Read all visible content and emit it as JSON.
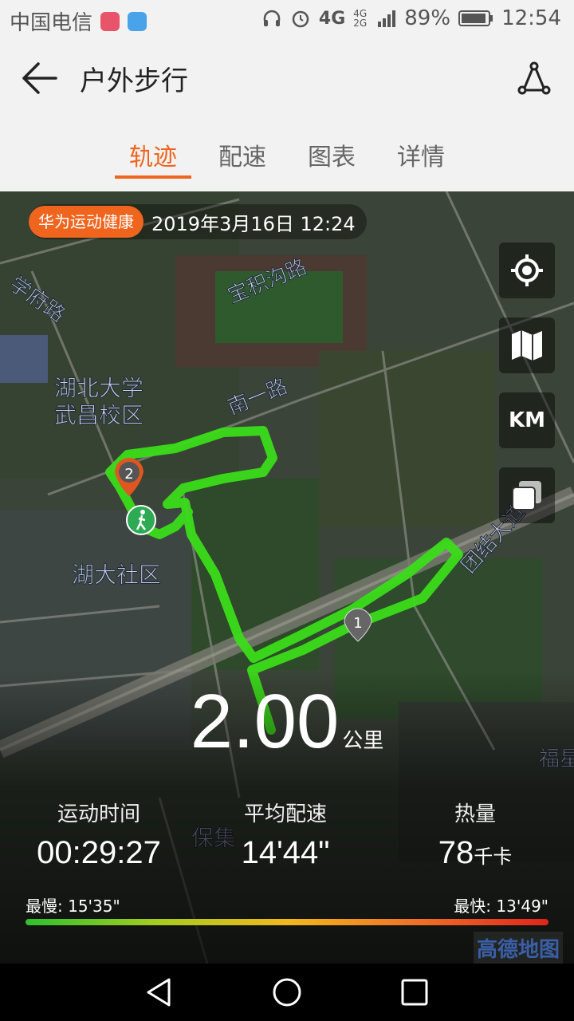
{
  "status_bar": {
    "carrier": "中国电信",
    "network": "4G",
    "network_small": "4G 2G",
    "battery": "89%",
    "time": "12:54"
  },
  "header": {
    "title": "户外步行"
  },
  "tabs": [
    {
      "label": "轨迹",
      "active": true
    },
    {
      "label": "配速",
      "active": false
    },
    {
      "label": "图表",
      "active": false
    },
    {
      "label": "详情",
      "active": false
    }
  ],
  "map": {
    "badge": "华为运动健康",
    "datetime": "2019年3月16日 12:24",
    "unit_button": "KM",
    "labels": [
      "学府路",
      "宝积沟路",
      "南一路",
      "湖北大学",
      "武昌校区",
      "湖大社区",
      "团结大道",
      "福星",
      "保集"
    ],
    "markers": [
      "1",
      "2"
    ],
    "route_color": "#3bdc1a",
    "provider": "高德地图"
  },
  "summary": {
    "distance": "2.00",
    "distance_unit": "公里",
    "stats": [
      {
        "label": "运动时间",
        "value": "00:29:27",
        "unit": ""
      },
      {
        "label": "平均配速",
        "value": "14'44\"",
        "unit": ""
      },
      {
        "label": "热量",
        "value": "78",
        "unit": "千卡"
      }
    ],
    "slowest_label": "最慢:",
    "slowest_value": "15'35\"",
    "fastest_label": "最快:",
    "fastest_value": "13'49\""
  }
}
